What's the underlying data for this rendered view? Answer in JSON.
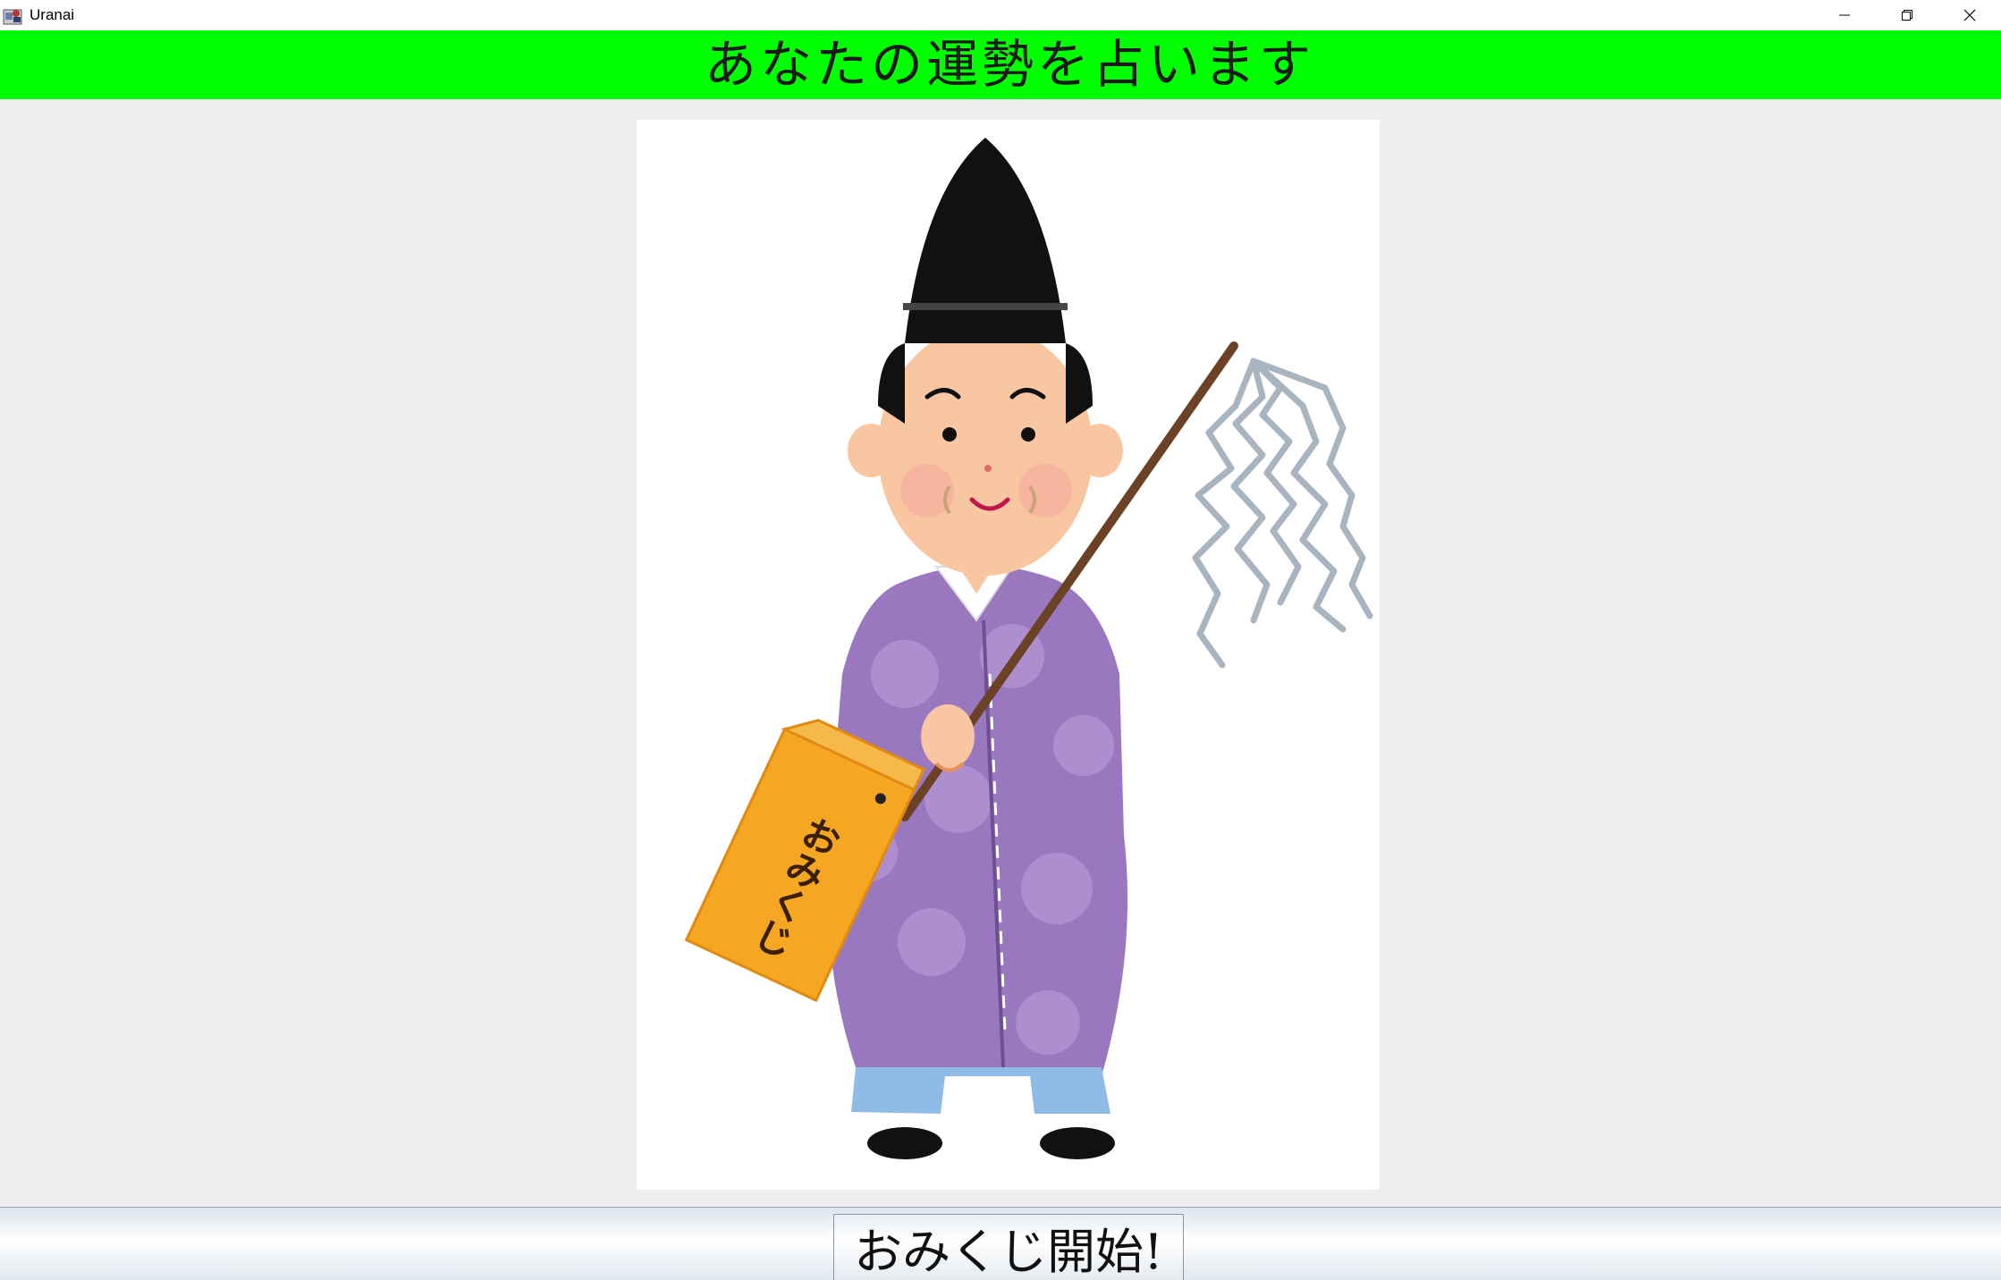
{
  "window": {
    "title": "Uranai",
    "icon": "java-app-icon",
    "controls": {
      "minimize_icon": "minimize-icon",
      "restore_icon": "restore-icon",
      "close_icon": "close-icon"
    }
  },
  "header": {
    "text": "あなたの運勢を占います",
    "background": "#00ff00"
  },
  "illustration": {
    "description_icon": "shinto-priest-omikuji-illustration",
    "box_text": "おみくじ"
  },
  "footer": {
    "button_label": "おみくじ開始!"
  }
}
